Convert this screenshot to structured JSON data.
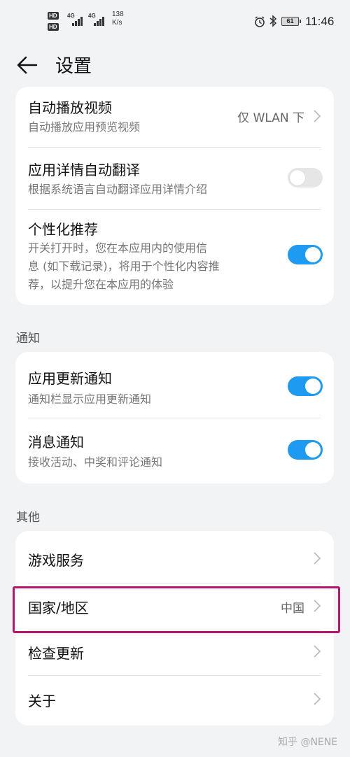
{
  "status_bar": {
    "hd_label": "HD",
    "net1": "4G",
    "net2": "4G",
    "speed_value": "138",
    "speed_unit": "K/s",
    "battery": "61",
    "time": "11:46"
  },
  "header": {
    "title": "设置"
  },
  "general_card": {
    "autoplay": {
      "title": "自动播放视频",
      "subtitle": "自动播放应用预览视频",
      "value": "仅 WLAN 下"
    },
    "auto_translate": {
      "title": "应用详情自动翻译",
      "subtitle": "根据系统语言自动翻译应用详情介绍",
      "enabled": false
    },
    "personalized": {
      "title": "个性化推荐",
      "subtitle_lines": [
        "开关打开时，您在本应用内的使用信",
        "息 (如下载记录)，将用于个性化内容推",
        "荐，以提升您在本应用的体验"
      ],
      "enabled": true
    }
  },
  "notifications": {
    "section_label": "通知",
    "update_notify": {
      "title": "应用更新通知",
      "subtitle": "通知栏显示应用更新通知",
      "enabled": true
    },
    "message_notify": {
      "title": "消息通知",
      "subtitle": "接收活动、中奖和评论通知",
      "enabled": true
    }
  },
  "other": {
    "section_label": "其他",
    "game_service": {
      "title": "游戏服务"
    },
    "region": {
      "title": "国家/地区",
      "value": "中国"
    },
    "check_update": {
      "title": "检查更新"
    },
    "about": {
      "title": "关于"
    }
  },
  "watermark": "知乎 @NENE",
  "colors": {
    "accent": "#1e9bf0",
    "highlight": "#b8156d",
    "background": "#f1f3f5"
  }
}
